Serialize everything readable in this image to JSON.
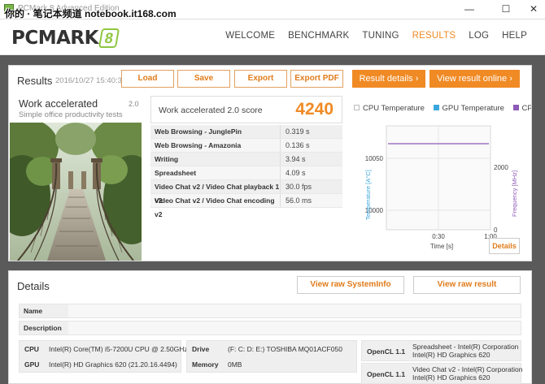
{
  "window": {
    "title": "PCMark 8 Advanced Edition",
    "watermark": "你的 · 笔记本频道 notebook.it168.com",
    "minimize": "—",
    "maximize": "☐",
    "close": "✕"
  },
  "header": {
    "logo_text": "PCMARK",
    "logo_num": "8",
    "nav": [
      "WELCOME",
      "BENCHMARK",
      "TUNING",
      "RESULTS",
      "LOG",
      "HELP"
    ],
    "active_nav": "RESULTS"
  },
  "results": {
    "title": "Results",
    "date": "2016/10/27 15:40:34",
    "buttons": [
      "Load",
      "Save",
      "Export",
      "Export PDF"
    ],
    "result_details": "Result details ›",
    "validate_online": "View result online ›",
    "test": {
      "name": "Work accelerated",
      "version": "2.0",
      "subtitle": "Simple office productivity tests"
    },
    "score": {
      "label": "Work accelerated 2.0 score",
      "value": "4240"
    },
    "subtests": [
      {
        "name": "Web Browsing - JunglePin",
        "value": "0.319 s"
      },
      {
        "name": "Web Browsing - Amazonia",
        "value": "0.136 s"
      },
      {
        "name": "Writing",
        "value": "3.94 s"
      },
      {
        "name": "Spreadsheet",
        "value": "4.09 s"
      },
      {
        "name": "Video Chat v2 / Video Chat playback 1 v2",
        "value": "30.0 fps"
      },
      {
        "name": "Video Chat v2 / Video Chat encoding v2",
        "value": "56.0 ms"
      }
    ],
    "chart": {
      "legend": [
        {
          "name": "CPU Temperature",
          "color": "#ffffff",
          "border": "#bbbbbb"
        },
        {
          "name": "GPU Temperature",
          "color": "#3aa6dc",
          "border": "#3aa6dc"
        },
        {
          "name": "CPU Clock Frequency",
          "color": "#8e5ab8",
          "border": "#8e5ab8"
        }
      ],
      "y_left_label": "Temperature [A°C]",
      "y_left_ticks": [
        "10050",
        "10000"
      ],
      "y_right_label": "Frequency [MHz]",
      "y_right_ticks": [
        "2000",
        "0"
      ],
      "x_ticks": [
        "0:30",
        "1:00"
      ],
      "x_label": "Time [s]",
      "line_color": "#8e5ab8",
      "details_button": "Details"
    }
  },
  "details": {
    "title": "Details",
    "view_systeminfo": "View raw SystemInfo",
    "view_result": "View raw result",
    "name_label": "Name",
    "description_label": "Description",
    "cpu_label": "CPU",
    "cpu_value": "Intel(R) Core(TM) i5-7200U CPU @ 2.50GHz",
    "gpu_label": "GPU",
    "gpu_value": "Intel(R) HD Graphics 620 (21.20.16.4494)",
    "drive_label": "Drive",
    "drive_value": "(F: C: D: E:) TOSHIBA MQ01ACF050",
    "memory_label": "Memory",
    "memory_value": "0MB",
    "opencl": [
      {
        "label": "OpenCL 1.1",
        "line1": "Spreadsheet - Intel(R) Corporation",
        "line2": "Intel(R) HD Graphics 620"
      },
      {
        "label": "OpenCL 1.1",
        "line1": "Video Chat v2 - Intel(R) Corporation",
        "line2": "Intel(R) HD Graphics 620"
      }
    ]
  }
}
